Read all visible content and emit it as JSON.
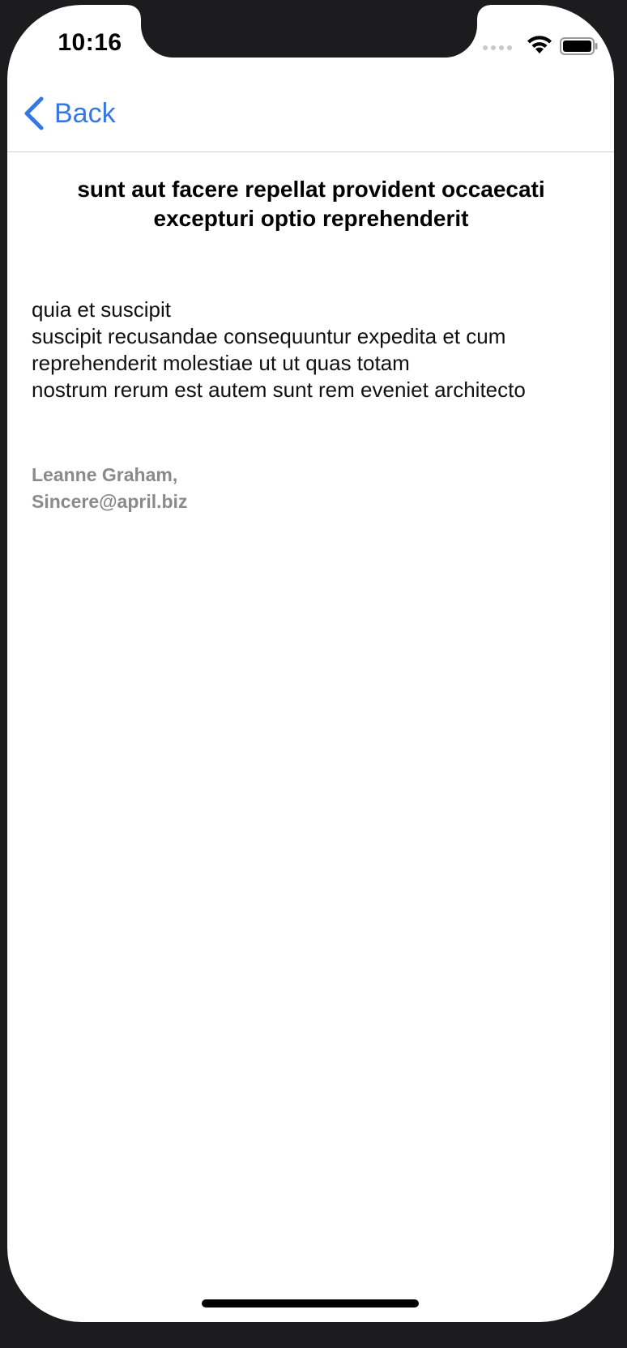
{
  "status_bar": {
    "time": "10:16"
  },
  "nav": {
    "back_label": "Back",
    "accent_color": "#3578e5"
  },
  "post": {
    "title": "sunt aut facere repellat provident occaecati excepturi optio reprehenderit",
    "body": "quia et suscipit\nsuscipit recusandae consequuntur expedita et cum reprehenderit molestiae ut ut quas totam\nnostrum rerum est autem sunt rem eveniet architecto",
    "author_name": "Leanne Graham,",
    "author_email": "Sincere@april.biz"
  },
  "icons": {
    "back": "chevron-left-icon",
    "signal": "signal-icon",
    "wifi": "wifi-icon",
    "battery": "battery-icon"
  }
}
